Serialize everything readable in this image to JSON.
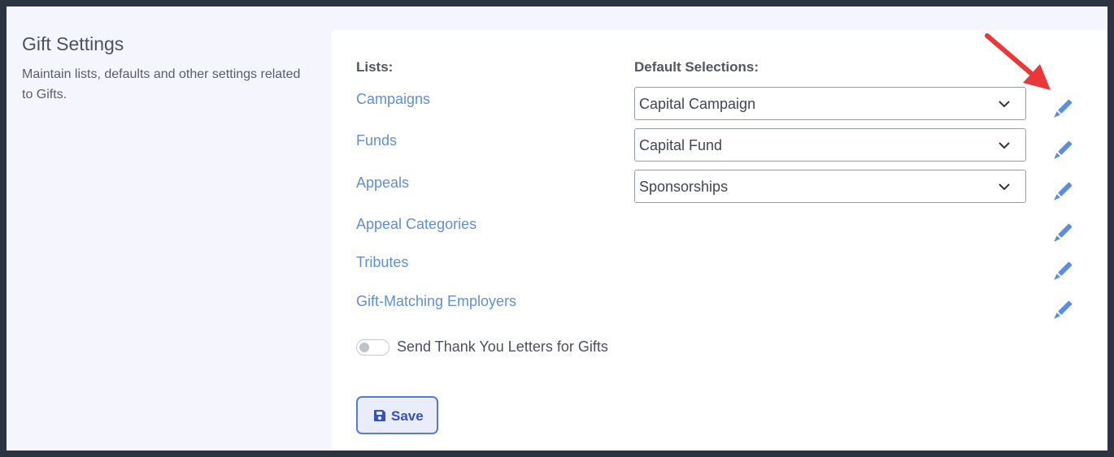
{
  "page": {
    "title": "Gift Settings",
    "description": "Maintain lists, defaults and other settings related to Gifts."
  },
  "headers": {
    "lists": "Lists:",
    "defaults": "Default Selections:"
  },
  "lists": [
    {
      "label": "Campaigns",
      "default": "Capital Campaign"
    },
    {
      "label": "Funds",
      "default": "Capital Fund"
    },
    {
      "label": "Appeals",
      "default": "Sponsorships"
    },
    {
      "label": "Appeal Categories"
    },
    {
      "label": "Tributes"
    },
    {
      "label": "Gift-Matching Employers"
    }
  ],
  "toggle": {
    "label": "Send Thank You Letters for Gifts",
    "state": "off"
  },
  "save": {
    "label": "Save"
  },
  "colors": {
    "link": "#5f8fd9",
    "edit_icon": "#5c8ee0",
    "annotation_arrow": "#e8383a",
    "save_border": "#5a78d6"
  }
}
